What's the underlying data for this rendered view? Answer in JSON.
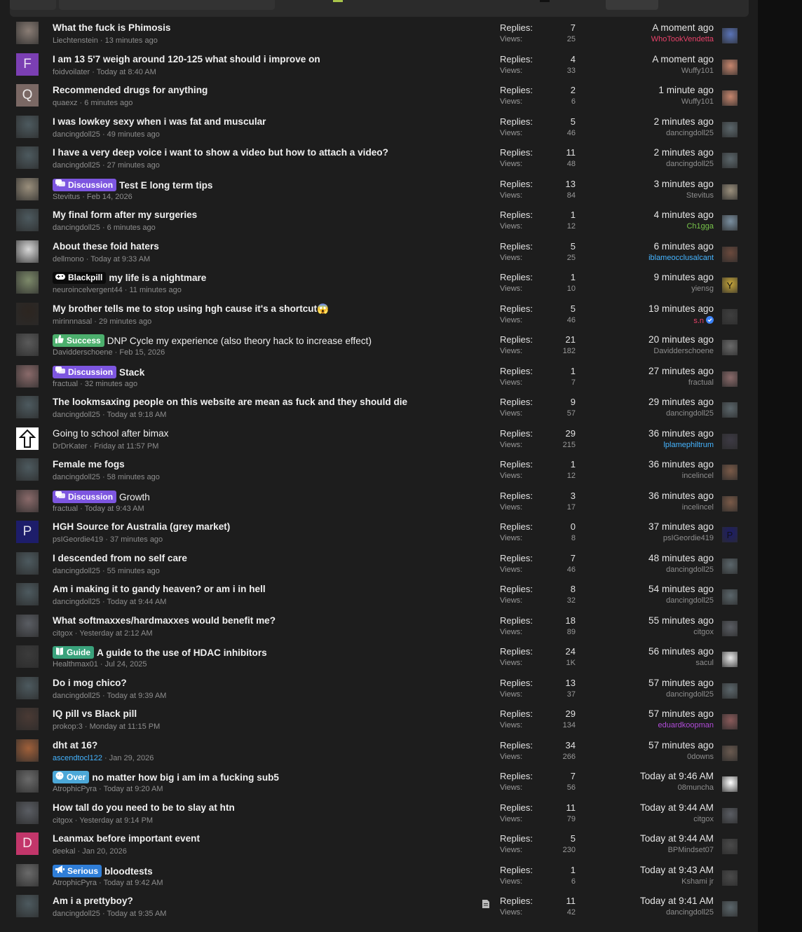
{
  "labels": {
    "replies": "Replies:",
    "views": "Views:"
  },
  "colors": {
    "discussion": "#7d56e0",
    "blackpill": "#0b0b0b",
    "success": "#4caf6d",
    "guide": "#3aa27c",
    "over": "#4ca8d8",
    "serious": "#2f7ed8"
  },
  "threads": [
    {
      "title": "What the fuck is Phimosis",
      "author": "Liechtenstein",
      "date": "13 minutes ago",
      "replies": "7",
      "views": "25",
      "last_time": "A moment ago",
      "last_user": "WhoTookVendetta",
      "last_user_style": "red",
      "avatar": {
        "type": "photo",
        "color": "#8a7d75",
        "letter": ""
      },
      "mini": {
        "color": "#5a74b8",
        "letter": ""
      }
    },
    {
      "title": "I am 13 5'7 weigh around 120-125 what should i improve on",
      "author": "foidvoilater",
      "date": "Today at 8:40 AM",
      "replies": "4",
      "views": "33",
      "last_time": "A moment ago",
      "last_user": "Wuffy101",
      "avatar": {
        "type": "letter",
        "color": "#7b3fb3",
        "letter": "F"
      },
      "mini": {
        "color": "#c7866e",
        "letter": ""
      }
    },
    {
      "title": "Recommended drugs for anything",
      "author": "quaexz",
      "date": "6 minutes ago",
      "replies": "2",
      "views": "6",
      "last_time": "1 minute ago",
      "last_user": "Wuffy101",
      "avatar": {
        "type": "letter",
        "color": "#7a6864",
        "letter": "Q"
      },
      "mini": {
        "color": "#c7866e",
        "letter": ""
      }
    },
    {
      "title": "I was lowkey sexy when i was fat and muscular",
      "author": "dancingdoll25",
      "date": "49 minutes ago",
      "replies": "5",
      "views": "46",
      "last_time": "2 minutes ago",
      "last_user": "dancingdoll25",
      "avatar": {
        "type": "photo",
        "color": "#4d5a5f",
        "letter": ""
      },
      "mini": {
        "color": "#5b666b",
        "letter": ""
      }
    },
    {
      "title": "I have a very deep voice i want to show a video but how to attach a video?",
      "author": "dancingdoll25",
      "date": "27 minutes ago",
      "replies": "11",
      "views": "48",
      "last_time": "2 minutes ago",
      "last_user": "dancingdoll25",
      "avatar": {
        "type": "photo",
        "color": "#4d5a5f",
        "letter": ""
      },
      "mini": {
        "color": "#5b666b",
        "letter": ""
      }
    },
    {
      "prefix": "Discussion",
      "prefix_style": "discussion",
      "prefix_icon": "chat-bubbles-icon",
      "title": "Test E long term tips",
      "author": "Stevitus",
      "date": "Feb 14, 2026",
      "replies": "13",
      "views": "84",
      "last_time": "3 minutes ago",
      "last_user": "Stevitus",
      "avatar": {
        "type": "photo",
        "color": "#9a8f7c",
        "letter": ""
      },
      "mini": {
        "color": "#9a8f7c",
        "letter": ""
      }
    },
    {
      "title": "My final form after my surgeries",
      "author": "dancingdoll25",
      "date": "6 minutes ago",
      "replies": "1",
      "views": "12",
      "last_time": "4 minutes ago",
      "last_user": "Ch1gga",
      "last_user_style": "green",
      "avatar": {
        "type": "photo",
        "color": "#4d5a5f",
        "letter": ""
      },
      "mini": {
        "color": "#7a8fa0",
        "letter": ""
      }
    },
    {
      "title": "About these foid haters",
      "author": "dellmono",
      "date": "Today at 9:33 AM",
      "replies": "5",
      "views": "25",
      "last_time": "6 minutes ago",
      "last_user": "iblameocclusalcant",
      "last_user_style": "blue",
      "avatar": {
        "type": "photo",
        "color": "#d8d8d8",
        "letter": ""
      },
      "mini": {
        "color": "#6b4a3d",
        "letter": ""
      }
    },
    {
      "prefix": "Blackpill",
      "prefix_style": "blackpill",
      "prefix_icon": "gamepad-icon",
      "title": "my life is a nightmare",
      "author": "neuroincelvergent44",
      "date": "11 minutes ago",
      "replies": "1",
      "views": "10",
      "last_time": "9 minutes ago",
      "last_user": "yiensg",
      "avatar": {
        "type": "photo",
        "color": "#7d8a6a",
        "letter": ""
      },
      "mini": {
        "color": "#c9a83a",
        "letter": "Y"
      }
    },
    {
      "title": "My brother tells me to stop using hgh cause it's a shortcut",
      "title_emoji": "😱",
      "author": "mirinnnasal",
      "date": "29 minutes ago",
      "replies": "5",
      "views": "46",
      "last_time": "19 minutes ago",
      "last_user": "s.n",
      "last_user_style": "red",
      "last_user_badge": "verified-badge-icon",
      "avatar": {
        "type": "photo",
        "color": "#2c2520",
        "letter": ""
      },
      "mini": {
        "color": "#3f3f3f",
        "letter": ""
      }
    },
    {
      "prefix": "Success",
      "prefix_style": "success",
      "prefix_icon": "thumbs-up-icon",
      "title": "DNP Cycle my experience (also theory hack to increase effect)",
      "plain": true,
      "author": "Davidderschoene",
      "date": "Feb 15, 2026",
      "replies": "21",
      "views": "182",
      "last_time": "20 minutes ago",
      "last_user": "Davidderschoene",
      "avatar": {
        "type": "photo",
        "color": "#5a5a5a",
        "letter": ""
      },
      "mini": {
        "color": "#6a6a6a",
        "letter": ""
      }
    },
    {
      "prefix": "Discussion",
      "prefix_style": "discussion",
      "prefix_icon": "chat-bubbles-icon",
      "title": "Stack",
      "author": "fractual",
      "date": "32 minutes ago",
      "replies": "1",
      "views": "7",
      "last_time": "27 minutes ago",
      "last_user": "fractual",
      "avatar": {
        "type": "photo",
        "color": "#8a6a6a",
        "letter": ""
      },
      "mini": {
        "color": "#8a6a6a",
        "letter": ""
      }
    },
    {
      "title": "The lookmsaxing people on this website are mean as fuck and they should die",
      "author": "dancingdoll25",
      "date": "Today at 9:18 AM",
      "replies": "9",
      "views": "57",
      "last_time": "29 minutes ago",
      "last_user": "dancingdoll25",
      "avatar": {
        "type": "photo",
        "color": "#4d5a5f",
        "letter": ""
      },
      "mini": {
        "color": "#5b666b",
        "letter": ""
      }
    },
    {
      "title": "Going to school after bimax",
      "plain": true,
      "author": "DrDrKater",
      "date": "Friday at 11:57 PM",
      "replies": "29",
      "views": "215",
      "last_time": "36 minutes ago",
      "last_user": "lplamephiltrum",
      "last_user_style": "blue",
      "avatar": {
        "type": "arrow",
        "color": "#ffffff",
        "letter": ""
      },
      "mini": {
        "color": "#3d3a44",
        "letter": ""
      }
    },
    {
      "title": "Female me fogs",
      "author": "dancingdoll25",
      "date": "58 minutes ago",
      "replies": "1",
      "views": "12",
      "last_time": "36 minutes ago",
      "last_user": "incelincel",
      "avatar": {
        "type": "photo",
        "color": "#4d5a5f",
        "letter": ""
      },
      "mini": {
        "color": "#7a5a48",
        "letter": ""
      }
    },
    {
      "prefix": "Discussion",
      "prefix_style": "discussion",
      "prefix_icon": "chat-bubbles-icon",
      "title": "Growth",
      "plain": true,
      "author": "fractual",
      "date": "Today at 9:43 AM",
      "replies": "3",
      "views": "17",
      "last_time": "36 minutes ago",
      "last_user": "incelincel",
      "avatar": {
        "type": "photo",
        "color": "#8a6a6a",
        "letter": ""
      },
      "mini": {
        "color": "#7a5a48",
        "letter": ""
      }
    },
    {
      "title": "HGH Source for Australia (grey market)",
      "author": "psIGeordie419",
      "date": "37 minutes ago",
      "replies": "0",
      "views": "8",
      "last_time": "37 minutes ago",
      "last_user": "psIGeordie419",
      "avatar": {
        "type": "letter",
        "color": "#1d1d6a",
        "letter": "P"
      },
      "mini": {
        "color": "#1d1d6a",
        "letter": "P"
      }
    },
    {
      "title": "I descended from no self care",
      "author": "dancingdoll25",
      "date": "55 minutes ago",
      "replies": "7",
      "views": "46",
      "last_time": "48 minutes ago",
      "last_user": "dancingdoll25",
      "avatar": {
        "type": "photo",
        "color": "#4d5a5f",
        "letter": ""
      },
      "mini": {
        "color": "#5b666b",
        "letter": ""
      }
    },
    {
      "title": "Am i making it to gandy heaven? or am i in hell",
      "author": "dancingdoll25",
      "date": "Today at 9:44 AM",
      "replies": "8",
      "views": "32",
      "last_time": "54 minutes ago",
      "last_user": "dancingdoll25",
      "avatar": {
        "type": "photo",
        "color": "#4d5a5f",
        "letter": ""
      },
      "mini": {
        "color": "#5b666b",
        "letter": ""
      }
    },
    {
      "title": "What softmaxxes/hardmaxxes would benefit me?",
      "author": "citgox",
      "date": "Yesterday at 2:12 AM",
      "replies": "18",
      "views": "89",
      "last_time": "55 minutes ago",
      "last_user": "citgox",
      "avatar": {
        "type": "photo",
        "color": "#5a5d63",
        "letter": ""
      },
      "mini": {
        "color": "#5a5d63",
        "letter": ""
      }
    },
    {
      "prefix": "Guide",
      "prefix_style": "guide",
      "prefix_icon": "book-icon",
      "title": "A guide to the use of HDAC inhibitors",
      "author": "Healthmax01",
      "date": "Jul 24, 2025",
      "replies": "24",
      "views": "1K",
      "last_time": "56 minutes ago",
      "last_user": "sacul",
      "avatar": {
        "type": "photo",
        "color": "#3b3b3b",
        "letter": ""
      },
      "mini": {
        "color": "#e8e8e8",
        "letter": ""
      }
    },
    {
      "title": "Do i mog chico?",
      "author": "dancingdoll25",
      "date": "Today at 9:39 AM",
      "replies": "13",
      "views": "37",
      "last_time": "57 minutes ago",
      "last_user": "dancingdoll25",
      "avatar": {
        "type": "photo",
        "color": "#4d5a5f",
        "letter": ""
      },
      "mini": {
        "color": "#5b666b",
        "letter": ""
      }
    },
    {
      "title": "IQ pill vs Black pill",
      "author": "prokop:3",
      "date": "Monday at 11:15 PM",
      "replies": "29",
      "views": "134",
      "last_time": "57 minutes ago",
      "last_user": "eduardkoopman",
      "last_user_style": "purple",
      "avatar": {
        "type": "photo",
        "color": "#4a3a34",
        "letter": ""
      },
      "mini": {
        "color": "#8a5a5a",
        "letter": ""
      }
    },
    {
      "title": "dht at 16?",
      "author": "ascendtocl122",
      "author_style": "blue",
      "date": "Jan 29, 2026",
      "replies": "34",
      "views": "266",
      "last_time": "57 minutes ago",
      "last_user": "0downs",
      "avatar": {
        "type": "photo",
        "color": "#a0603a",
        "letter": ""
      },
      "mini": {
        "color": "#6a5a50",
        "letter": ""
      }
    },
    {
      "prefix": "Over",
      "prefix_style": "over",
      "prefix_icon": "sad-face-icon",
      "title": "no matter how big i am im a fucking sub5",
      "author": "AtrophicPyra",
      "date": "Today at 9:20 AM",
      "replies": "7",
      "views": "56",
      "last_time": "Today at 9:46 AM",
      "last_user": "08muncha",
      "avatar": {
        "type": "photo",
        "color": "#6a6a6a",
        "letter": ""
      },
      "mini": {
        "color": "#ffffff",
        "letter": ""
      }
    },
    {
      "title": "How tall do you need to be to slay at htn",
      "author": "citgox",
      "date": "Yesterday at 9:14 PM",
      "replies": "11",
      "views": "79",
      "last_time": "Today at 9:44 AM",
      "last_user": "citgox",
      "avatar": {
        "type": "photo",
        "color": "#5a5d63",
        "letter": ""
      },
      "mini": {
        "color": "#5a5d63",
        "letter": ""
      }
    },
    {
      "title": "Leanmax before important event",
      "author": "deekal",
      "date": "Jan 20, 2026",
      "replies": "5",
      "views": "230",
      "last_time": "Today at 9:44 AM",
      "last_user": "BPMindset07",
      "avatar": {
        "type": "letter",
        "color": "#c2366a",
        "letter": "D"
      },
      "mini": {
        "color": "#4a4a4a",
        "letter": ""
      }
    },
    {
      "prefix": "Serious",
      "prefix_style": "serious",
      "prefix_icon": "megaphone-icon",
      "title": "bloodtests",
      "author": "AtrophicPyra",
      "date": "Today at 9:42 AM",
      "replies": "1",
      "views": "6",
      "last_time": "Today at 9:43 AM",
      "last_user": "Kshami jr",
      "avatar": {
        "type": "photo",
        "color": "#6a6a6a",
        "letter": ""
      },
      "mini": {
        "color": "#4a4a4a",
        "letter": ""
      }
    },
    {
      "title": "Am i a prettyboy?",
      "author": "dancingdoll25",
      "date": "Today at 9:35 AM",
      "replies": "11",
      "views": "42",
      "last_time": "Today at 9:41 AM",
      "last_user": "dancingdoll25",
      "attachment": "document-icon",
      "avatar": {
        "type": "photo",
        "color": "#4d5a5f",
        "letter": ""
      },
      "mini": {
        "color": "#5b666b",
        "letter": ""
      }
    }
  ]
}
